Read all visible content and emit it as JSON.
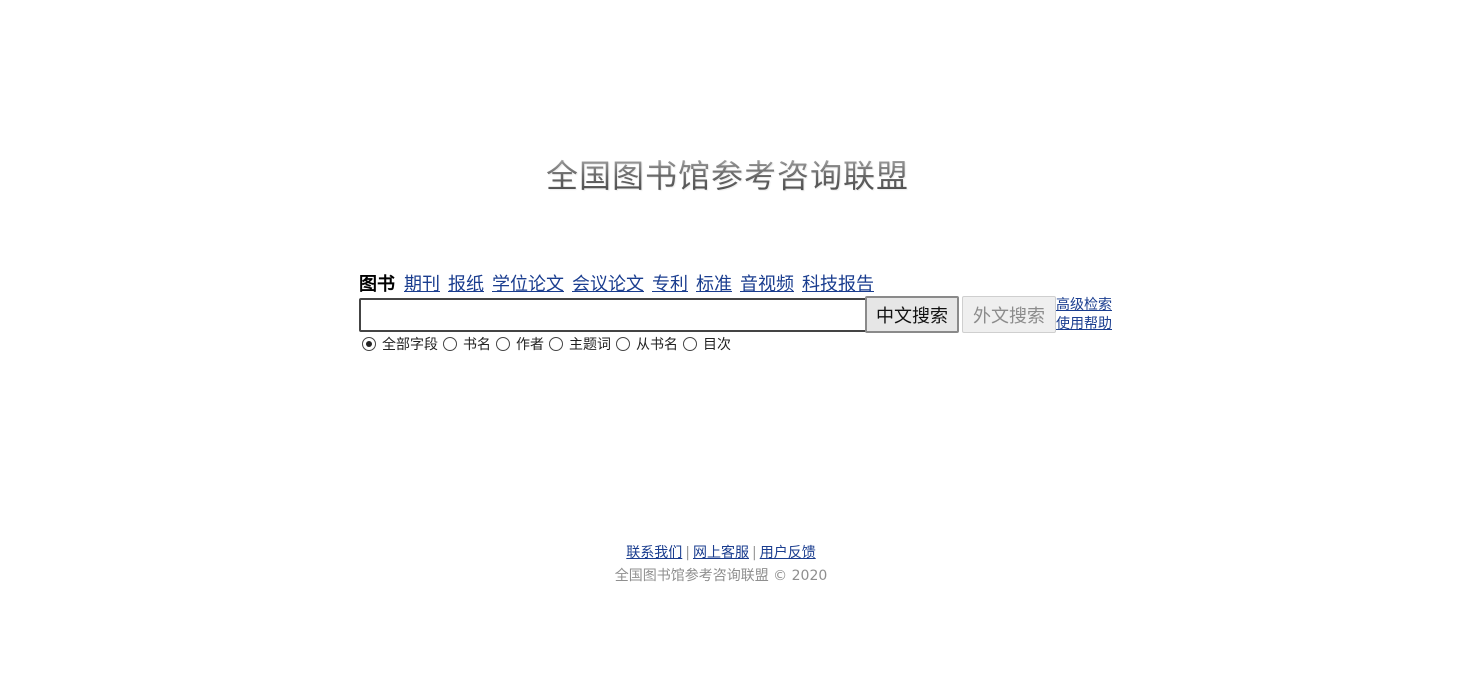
{
  "logo": {
    "text": "全国图书馆参考咨询联盟"
  },
  "tabs": {
    "active": "图书",
    "items": [
      "期刊",
      "报纸",
      "学位论文",
      "会议论文",
      "专利",
      "标准",
      "音视频",
      "科技报告"
    ]
  },
  "search": {
    "value": "",
    "placeholder": "",
    "chinese_button": "中文搜索",
    "foreign_button": "外文搜索",
    "advanced_link": "高级检索",
    "help_link": "使用帮助"
  },
  "fields": {
    "selected": "全部字段",
    "options": [
      "全部字段",
      "书名",
      "作者",
      "主题词",
      "从书名",
      "目次"
    ]
  },
  "footer": {
    "links": [
      "联系我们",
      "网上客服",
      "用户反馈"
    ],
    "separator": "|",
    "copyright": "全国图书馆参考咨询联盟 © 2020"
  },
  "colors": {
    "link": "#1a3d8f",
    "muted": "#8f8f8f"
  }
}
